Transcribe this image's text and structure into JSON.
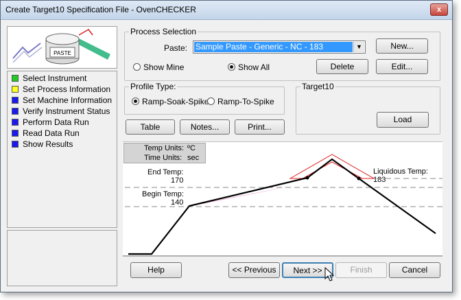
{
  "window": {
    "title": "Create Target10 Specification File - OvenCHECKER",
    "close_glyph": "x"
  },
  "logo": {
    "label": "PASTE"
  },
  "steps": [
    {
      "label": "Select Instrument",
      "color": "#22cc22"
    },
    {
      "label": "Set Process Information",
      "color": "#ffff22"
    },
    {
      "label": "Set Machine Information",
      "color": "#1a1aee"
    },
    {
      "label": "Verify Instrument Status",
      "color": "#1a1aee"
    },
    {
      "label": "Perform Data Run",
      "color": "#1a1aee"
    },
    {
      "label": "Read Data Run",
      "color": "#1a1aee"
    },
    {
      "label": "Show Results",
      "color": "#1a1aee"
    }
  ],
  "process": {
    "group_title": "Process Selection",
    "paste_label": "Paste:",
    "paste_value": "Sample Paste - Generic - NC - 183",
    "new_label": "New...",
    "show_mine": "Show Mine",
    "show_all": "Show All",
    "delete_label": "Delete",
    "edit_label": "Edit..."
  },
  "profile": {
    "group_title": "Profile Type:",
    "ramp_soak_spike": "Ramp-Soak-Spike",
    "ramp_to_spike": "Ramp-To-Spike"
  },
  "target": {
    "group_title": "Target10",
    "load_label": "Load"
  },
  "actions": {
    "table": "Table",
    "notes": "Notes...",
    "print": "Print..."
  },
  "chart": {
    "temp_units_label": "Temp Units:",
    "temp_units_value": "ºC",
    "time_units_label": "Time Units:",
    "time_units_value": "sec",
    "end_temp_label": "End Temp:",
    "end_temp_value": "170",
    "begin_temp_label": "Begin Temp:",
    "begin_temp_value": "140",
    "liquidous_label": "Liquidous Temp: 183"
  },
  "footer": {
    "help": "Help",
    "previous": "<< Previous",
    "next": "Next >>",
    "finish": "Finish",
    "cancel": "Cancel"
  }
}
